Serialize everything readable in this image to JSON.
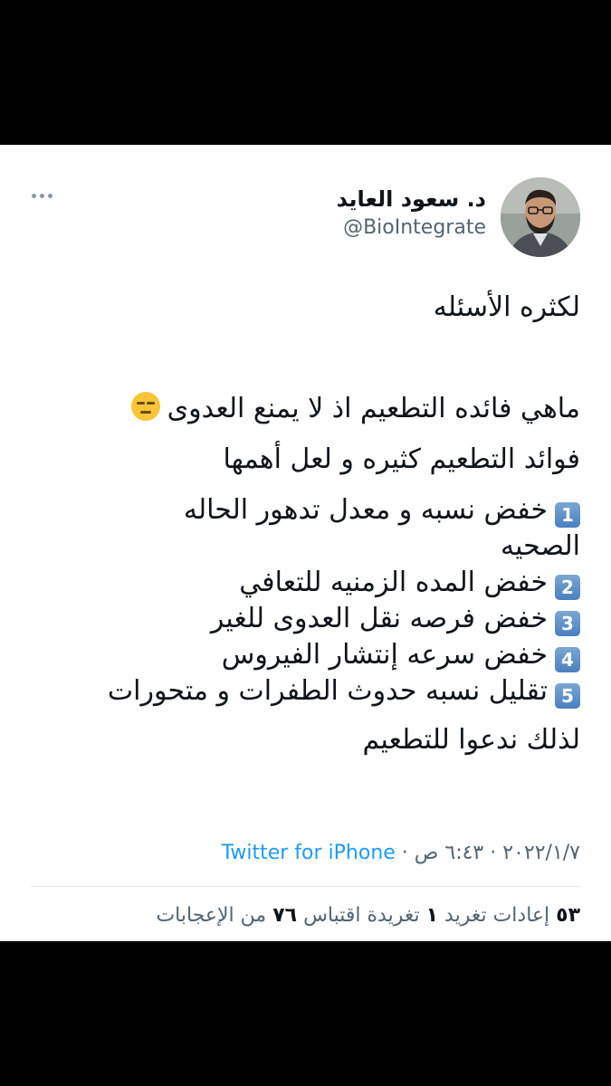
{
  "user": {
    "display_name": "د. سعود العايد",
    "handle": "@BioIntegrate"
  },
  "menu": {
    "icon": "more-horizontal-icon"
  },
  "tweet": {
    "intro": "لكثره الأسئله",
    "question": "ماهي فائده التطعيم اذ لا يمنع العدوى",
    "question_emoji": "expressionless-face-emoji",
    "benefits_intro": "فوائد التطعيم كثيره و لعل أهمها",
    "items": [
      {
        "num": "1",
        "line1": "خفض نسبه و معدل تدهور الحاله",
        "line2": "الصحيه"
      },
      {
        "num": "2",
        "line1": "خفض المده الزمنيه للتعافي"
      },
      {
        "num": "3",
        "line1": "خفض فرصه نقل العدوى للغير"
      },
      {
        "num": "4",
        "line1": "خفض سرعه إنتشار الفيروس"
      },
      {
        "num": "5",
        "line1": "تقليل نسبه حدوث الطفرات و متحورات"
      }
    ],
    "closing": "لذلك ندعوا للتطعيم"
  },
  "meta": {
    "date": "٢٠٢٢/١/٧",
    "time": "٦:٤٣ ص",
    "separator": "·",
    "source": "Twitter for iPhone"
  },
  "stats": {
    "retweets_count": "٥٣",
    "retweets_label": "إعادات تغريد",
    "quotes_count": "١",
    "quotes_label": "تغريدة اقتباس",
    "likes_count": "٧٦",
    "likes_label": "من الإعجابات"
  },
  "colors": {
    "link": "#1d9bf0",
    "secondary": "#536471",
    "text": "#0f1419"
  }
}
